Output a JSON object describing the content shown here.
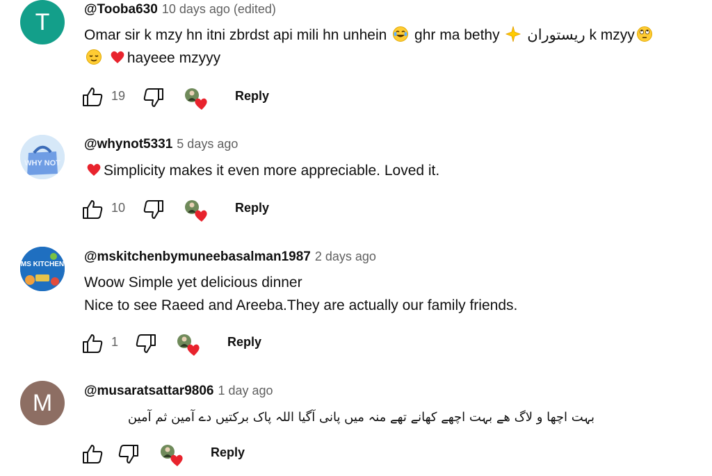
{
  "comments": [
    {
      "author": "@Tooba630",
      "time": "10 days ago (edited)",
      "avatar_letter": "T",
      "avatar_color": "#139f8a",
      "lines": [
        {
          "a": "Omar sir k mzy hn itni zbrdst api mili hn unhein",
          "b": "ghr ma bethy",
          "urdu": "ریستوران",
          "c": "k mzyy"
        },
        {
          "d": "hayeee mzyyy"
        }
      ],
      "likes": "19",
      "reply_label": "Reply"
    },
    {
      "author": "@whynot5331",
      "time": "5 days ago",
      "avatar_text": "WHY NOT",
      "avatar_color": "#6f9de4",
      "lines": [
        "Simplicity makes it even more appreciable. Loved it."
      ],
      "likes": "10",
      "reply_label": "Reply"
    },
    {
      "author": "@mskitchenbymuneebasalman1987",
      "time": "2 days ago",
      "avatar_text": "MS KITCHEN",
      "avatar_color": "#1f6fc0",
      "lines": [
        "Woow  Simple yet delicious dinner",
        "Nice to see Raeed and Areeba.They are actually our family friends."
      ],
      "likes": "1",
      "reply_label": "Reply"
    },
    {
      "author": "@musaratsattar9806",
      "time": "1 day ago",
      "avatar_letter": "M",
      "avatar_color": "#8d6e63",
      "lines": [
        "بہت اچھا و لاگ ھے  بہت اچھے  کھانے تھے  منہ میں  پانی آگیا اللہ پاک  برکتیں دے  آمین ثم آمین"
      ],
      "likes": "",
      "reply_label": "Reply"
    }
  ],
  "colors": {
    "heart": "#e8232d",
    "secondary_text": "#606060",
    "icon_stroke": "#0f0f0f"
  },
  "icons": [
    "thumbs-up-icon",
    "thumbs-down-icon",
    "creator-heart-icon",
    "laugh-emoji",
    "sparkle-emoji",
    "eye-roll-emoji",
    "relieved-emoji",
    "red-heart-emoji"
  ]
}
